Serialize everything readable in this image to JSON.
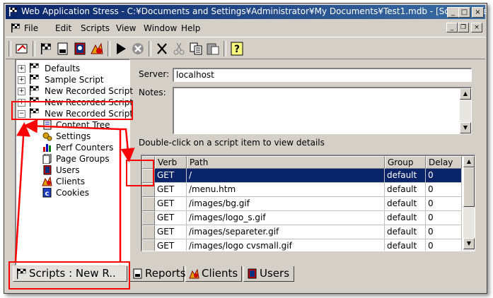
{
  "window": {
    "title": "Web Application Stress - C:¥Documents and Settings¥Administrator¥My Documents¥Test1.mdb - [Scripts : New ...",
    "min": "_",
    "max": "□",
    "close": "×"
  },
  "menu": [
    "File",
    "Edit",
    "Scripts",
    "View",
    "Window",
    "Help"
  ],
  "tree": {
    "items": [
      {
        "label": "Defaults",
        "expander": "+"
      },
      {
        "label": "Sample Script",
        "expander": "+"
      },
      {
        "label": "New Recorded Script",
        "expander": "+"
      },
      {
        "label": "New Recorded Script",
        "expander": "+"
      },
      {
        "label": "New Recorded Script",
        "expander": "−"
      }
    ],
    "children": [
      "Content Tree",
      "Settings",
      "Perf Counters",
      "Page Groups",
      "Users",
      "Clients",
      "Cookies"
    ]
  },
  "form": {
    "server_label": "Server:",
    "server_value": "localhost",
    "notes_label": "Notes:",
    "hint": "Double-click on a script item to view details"
  },
  "grid": {
    "columns": [
      "Verb",
      "Path",
      "Group",
      "Delay"
    ],
    "rows": [
      {
        "verb": "GET",
        "path": "/",
        "group": "default",
        "delay": "0"
      },
      {
        "verb": "GET",
        "path": "/menu.htm",
        "group": "default",
        "delay": "0"
      },
      {
        "verb": "GET",
        "path": "/images/bg.gif",
        "group": "default",
        "delay": "0"
      },
      {
        "verb": "GET",
        "path": "/images/logo_s.gif",
        "group": "default",
        "delay": "0"
      },
      {
        "verb": "GET",
        "path": "/images/separeter.gif",
        "group": "default",
        "delay": "0"
      },
      {
        "verb": "GET",
        "path": "/images/logo cvsmall.gif",
        "group": "default",
        "delay": "0"
      }
    ]
  },
  "tabs": [
    "Scripts : New R..",
    "Reports",
    "Clients",
    "Users"
  ],
  "colors": {
    "selection": "#0a246a",
    "annotation": "#ff0000"
  }
}
